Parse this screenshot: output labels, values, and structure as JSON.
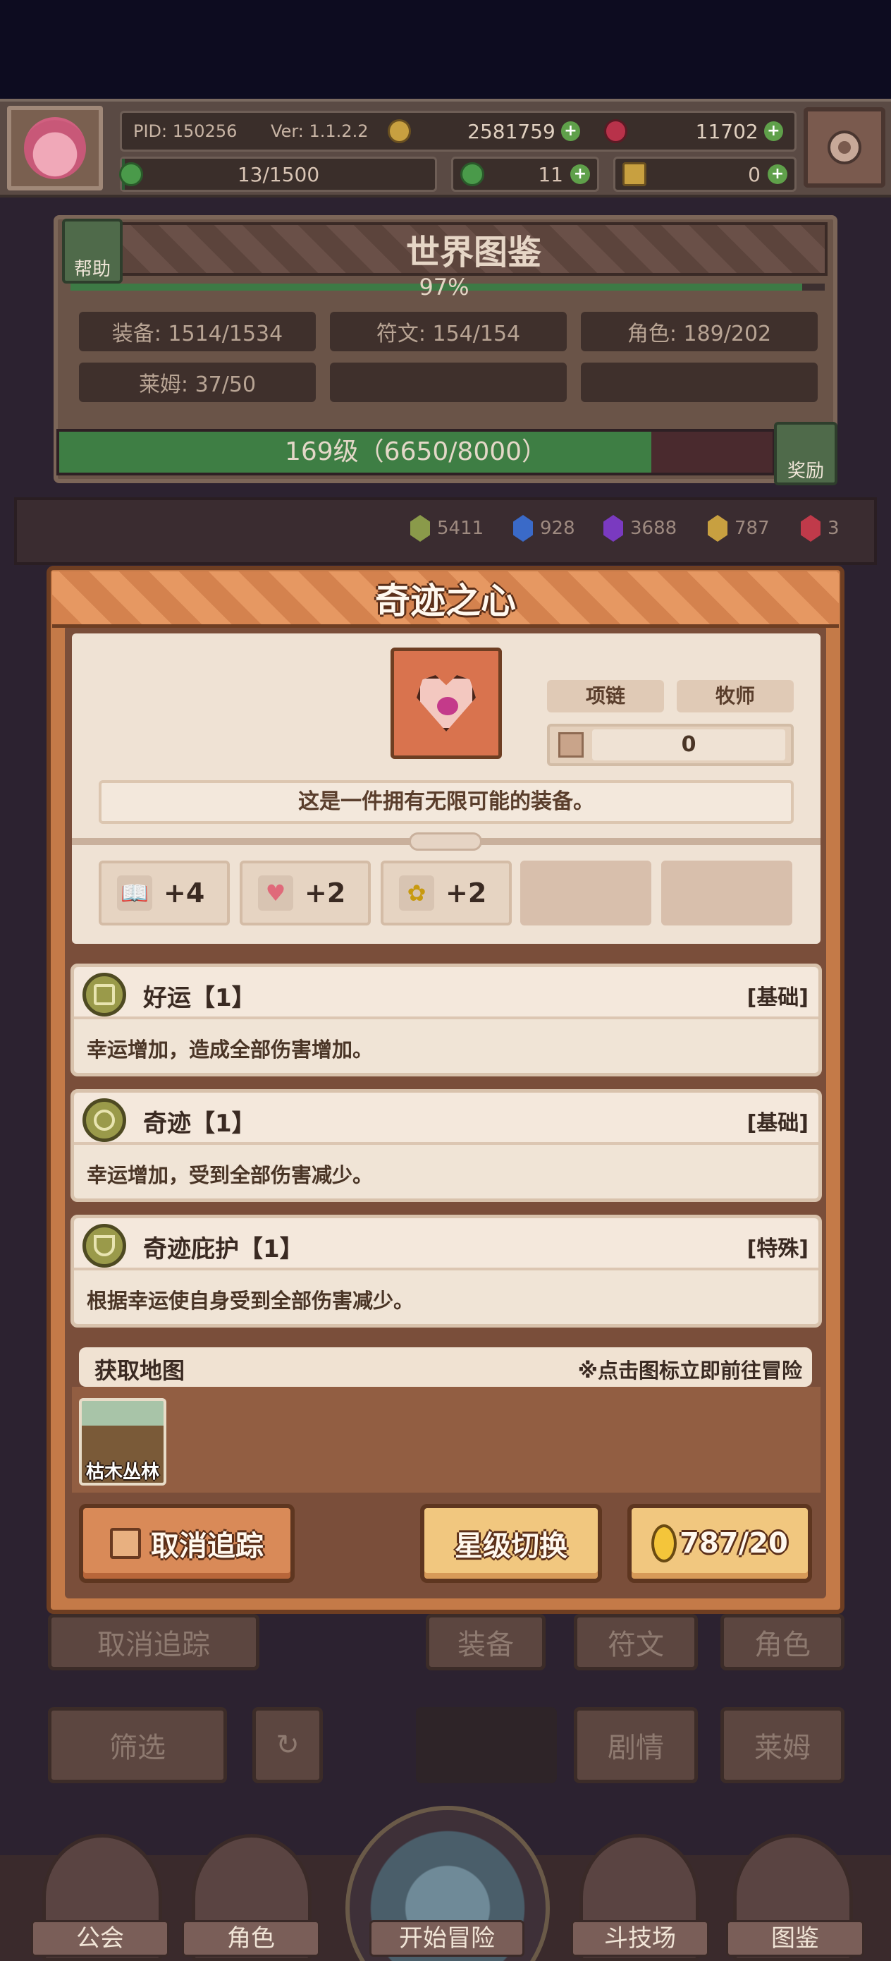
{
  "topbar": {
    "pid": "PID: 150256",
    "version": "Ver: 1.1.2.2",
    "gold": "2581759",
    "gems": "11702",
    "energy": "13/1500",
    "energy_fraction": 0.009,
    "clover": "11",
    "keys": "0"
  },
  "world": {
    "title": "世界图鉴",
    "help_label": "帮助",
    "percent": "97%",
    "percent_value": 0.97,
    "stats": [
      "装备: 1514/1534",
      "符文: 154/154",
      "角色: 189/202",
      "莱姆: 37/50"
    ],
    "level": "169级（6650/8000）",
    "level_fraction": 0.83,
    "reward_label": "奖励"
  },
  "resources": [
    {
      "value": "5411",
      "color": "#8a9a4a"
    },
    {
      "value": "928",
      "color": "#3a6ac8"
    },
    {
      "value": "3688",
      "color": "#7a3ac0"
    },
    {
      "value": "787",
      "color": "#c8a040"
    },
    {
      "value": "3",
      "color": "#c03a4a"
    }
  ],
  "background_controls": {
    "untrack": "取消追踪",
    "equipment": "装备",
    "rune": "符文",
    "role": "角色",
    "filter": "筛选",
    "story": "剧情",
    "lime": "莱姆"
  },
  "bottom_nav": {
    "guild": "公会",
    "role": "角色",
    "adventure": "开始冒险",
    "arena": "斗技场",
    "codex": "图鉴"
  },
  "modal": {
    "title": "奇迹之心",
    "tags": [
      "项链",
      "牧师"
    ],
    "count": "0",
    "description": "这是一件拥有无限可能的装备。",
    "stats": [
      {
        "icon": "book-icon",
        "glyph": "📖",
        "value": "+4"
      },
      {
        "icon": "heart-icon",
        "glyph": "♥",
        "value": "+2"
      },
      {
        "icon": "clover-icon",
        "glyph": "✿",
        "value": "+2"
      }
    ],
    "skills": [
      {
        "name": "好运【1】",
        "type": "[基础]",
        "desc": "幸运增加，造成全部伤害增加。"
      },
      {
        "name": "奇迹【1】",
        "type": "[基础]",
        "desc": "幸运增加，受到全部伤害减少。"
      },
      {
        "name": "奇迹庇护【1】",
        "type": "[特殊]",
        "desc": "根据幸运使自身受到全部伤害减少。"
      }
    ],
    "map_section": {
      "title": "获取地图",
      "hint": "※点击图标立即前往冒险",
      "maps": [
        {
          "label": "枯木丛林"
        }
      ]
    },
    "buttons": {
      "untrack": "取消追踪",
      "star_switch": "星级切换",
      "cost": "787/20"
    }
  },
  "colors": {
    "accent": "#c47a48",
    "card_bg": "#efe2d4",
    "button_gold": "#f1c77f",
    "progress_green": "#3e7e44"
  }
}
